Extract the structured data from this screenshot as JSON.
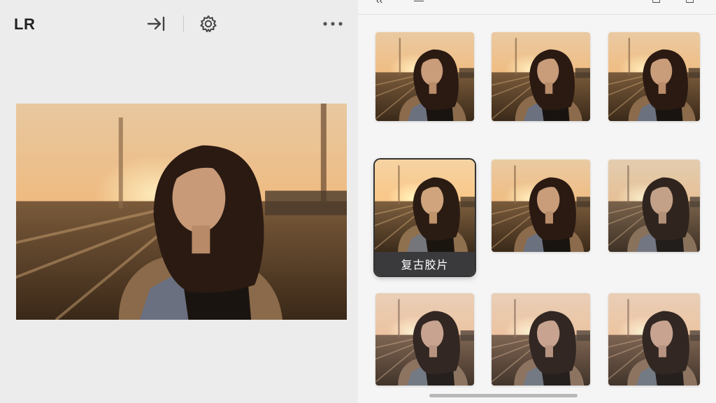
{
  "app": {
    "title": "LR"
  },
  "toolbar": {
    "export_icon": "arrow-right-to-bar-icon",
    "settings_icon": "gear-icon",
    "more_icon": "more-horizontal-icon"
  },
  "main_photo": {
    "subject": "portrait-at-sunset"
  },
  "presets": {
    "selected_label": "复古胶片",
    "items": [
      {
        "tone": "warm"
      },
      {
        "tone": "warm"
      },
      {
        "tone": "warm"
      },
      {
        "tone": "vintage",
        "label": "复古胶片",
        "selected": true
      },
      {
        "tone": "warm"
      },
      {
        "tone": "faded"
      },
      {
        "tone": "cool"
      },
      {
        "tone": "cool"
      },
      {
        "tone": "cool"
      }
    ]
  },
  "colors": {
    "accent": "#3a3a3c",
    "background": "#ececec"
  }
}
